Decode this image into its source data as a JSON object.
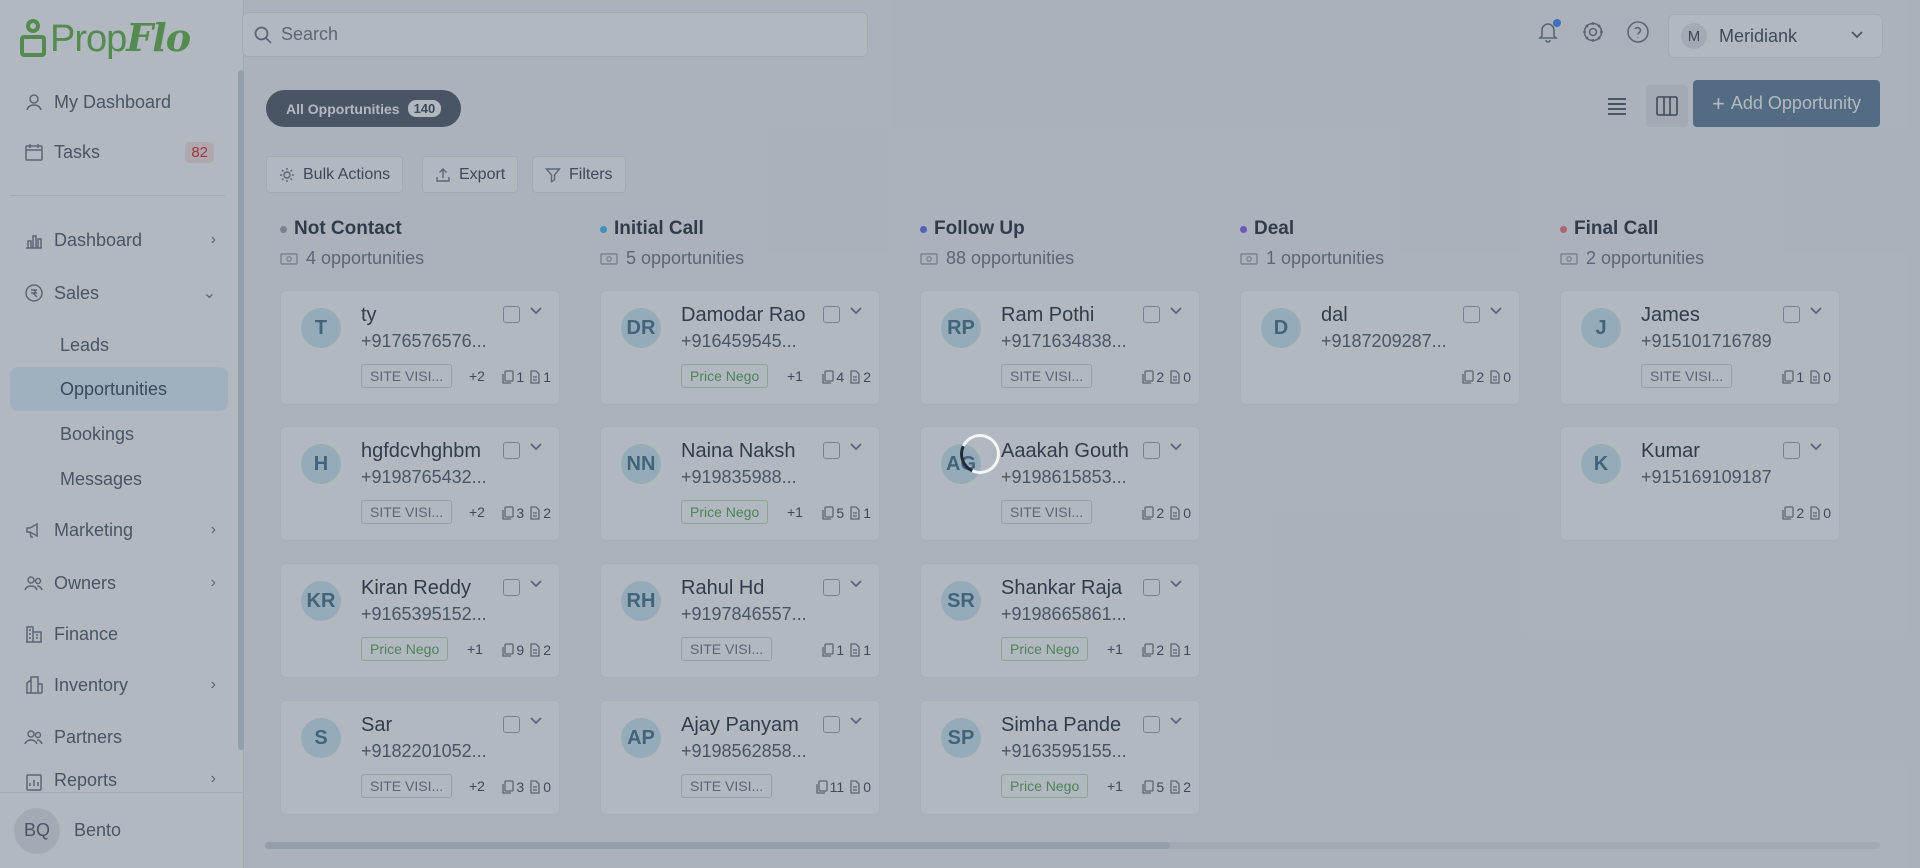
{
  "brand": {
    "prop": "Prop",
    "flo": "Flo"
  },
  "search": {
    "placeholder": "Search"
  },
  "org": {
    "initial": "M",
    "name": "Meridiank"
  },
  "sidebar": {
    "items": [
      {
        "label": "My Dashboard"
      },
      {
        "label": "Tasks",
        "badge": "82"
      },
      {
        "label": "Dashboard"
      },
      {
        "label": "Sales"
      },
      {
        "label": "Marketing"
      },
      {
        "label": "Owners"
      },
      {
        "label": "Finance"
      },
      {
        "label": "Inventory"
      },
      {
        "label": "Partners"
      },
      {
        "label": "Reports"
      }
    ],
    "sales_sub": [
      "Leads",
      "Opportunities",
      "Bookings",
      "Messages"
    ],
    "user": {
      "initials": "BQ",
      "name": "Bento"
    }
  },
  "toolbar": {
    "all_label": "All Opportunities",
    "all_count": "140",
    "add_label": "Add Opportunity",
    "bulk_label": "Bulk Actions",
    "export_label": "Export",
    "filters_label": "Filters"
  },
  "colors": {
    "accent": "#5d7d96",
    "brand": "#5fb23f"
  },
  "columns": [
    {
      "title": "Not Contact",
      "count_text": "4 opportunities",
      "dot": "#9ca3af",
      "cards": [
        {
          "initials": "T",
          "name": "ty",
          "phone": "+9176576576...",
          "tag": "SITE VISI...",
          "tag_style": "gray",
          "more": "+2",
          "a": "1",
          "b": "1"
        },
        {
          "initials": "H",
          "name": "hgfdcvhghbm",
          "phone": "+9198765432...",
          "tag": "SITE VISI...",
          "tag_style": "gray",
          "more": "+2",
          "a": "3",
          "b": "2"
        },
        {
          "initials": "KR",
          "name": "Kiran Reddy",
          "phone": "+9165395152...",
          "tag": "Price Nego",
          "tag_style": "green",
          "more": "+1",
          "a": "9",
          "b": "2"
        },
        {
          "initials": "S",
          "name": "Sar",
          "phone": "+9182201052...",
          "tag": "SITE VISI...",
          "tag_style": "gray",
          "more": "+2",
          "a": "3",
          "b": "0"
        }
      ]
    },
    {
      "title": "Initial Call",
      "count_text": "5 opportunities",
      "dot": "#38bdf8",
      "cards": [
        {
          "initials": "DR",
          "name": "Damodar Rao",
          "phone": "+916459545...",
          "tag": "Price Nego",
          "tag_style": "green",
          "more": "+1",
          "a": "4",
          "b": "2"
        },
        {
          "initials": "NN",
          "name": "Naina Naksh",
          "phone": "+919835988...",
          "tag": "Price Nego",
          "tag_style": "green",
          "more": "+1",
          "a": "5",
          "b": "1"
        },
        {
          "initials": "RH",
          "name": "Rahul Hd",
          "phone": "+9197846557...",
          "tag": "SITE VISI...",
          "tag_style": "gray",
          "more": "",
          "a": "1",
          "b": "1"
        },
        {
          "initials": "AP",
          "name": "Ajay Panyam",
          "phone": "+9198562858...",
          "tag": "SITE VISI...",
          "tag_style": "gray",
          "more": "",
          "a": "11",
          "b": "0"
        }
      ]
    },
    {
      "title": "Follow Up",
      "count_text": "88 opportunities",
      "dot": "#6366f1",
      "cards": [
        {
          "initials": "RP",
          "name": "Ram Pothi",
          "phone": "+9171634838...",
          "tag": "SITE VISI...",
          "tag_style": "gray",
          "more": "",
          "a": "2",
          "b": "0"
        },
        {
          "initials": "AG",
          "name": "Aaakah Gouth",
          "phone": "+9198615853...",
          "tag": "SITE VISI...",
          "tag_style": "gray",
          "more": "",
          "a": "2",
          "b": "0"
        },
        {
          "initials": "SR",
          "name": "Shankar Raja",
          "phone": "+9198665861...",
          "tag": "Price Nego",
          "tag_style": "green",
          "more": "+1",
          "a": "2",
          "b": "1"
        },
        {
          "initials": "SP",
          "name": "Simha Pande",
          "phone": "+9163595155...",
          "tag": "Price Nego",
          "tag_style": "green",
          "more": "+1",
          "a": "5",
          "b": "2"
        }
      ]
    },
    {
      "title": "Deal",
      "count_text": "1 opportunities",
      "dot": "#8b5cf6",
      "cards": [
        {
          "initials": "D",
          "name": "dal",
          "phone": "+9187209287...",
          "tag": "",
          "tag_style": "none",
          "more": "",
          "a": "2",
          "b": "0"
        }
      ]
    },
    {
      "title": "Final Call",
      "count_text": "2 opportunities",
      "dot": "#f87171",
      "cards": [
        {
          "initials": "J",
          "name": "James",
          "phone": "+915101716789",
          "tag": "SITE VISI...",
          "tag_style": "gray",
          "more": "",
          "a": "1",
          "b": "0"
        },
        {
          "initials": "K",
          "name": "Kumar",
          "phone": "+915169109187",
          "tag": "",
          "tag_style": "none",
          "more": "",
          "a": "2",
          "b": "0"
        }
      ]
    }
  ]
}
